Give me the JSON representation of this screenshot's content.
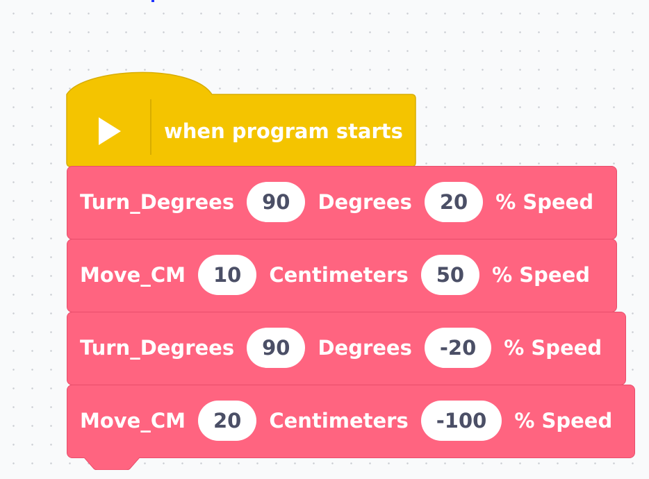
{
  "colors": {
    "hat": "#f4c400",
    "command": "#ff6480",
    "pill_text": "#4b4f66",
    "canvas": "#f9fafb"
  },
  "hat_block": {
    "icon": "play-icon",
    "label": "when program starts"
  },
  "blocks": [
    {
      "name": "Turn_Degrees",
      "value1": "90",
      "unit1": "Degrees",
      "value2": "20",
      "unit2": "% Speed"
    },
    {
      "name": "Move_CM",
      "value1": "10",
      "unit1": "Centimeters",
      "value2": "50",
      "unit2": "% Speed"
    },
    {
      "name": "Turn_Degrees",
      "value1": "90",
      "unit1": "Degrees",
      "value2": "-20",
      "unit2": "% Speed"
    },
    {
      "name": "Move_CM",
      "value1": "20",
      "unit1": "Centimeters",
      "value2": "-100",
      "unit2": "% Speed"
    }
  ]
}
